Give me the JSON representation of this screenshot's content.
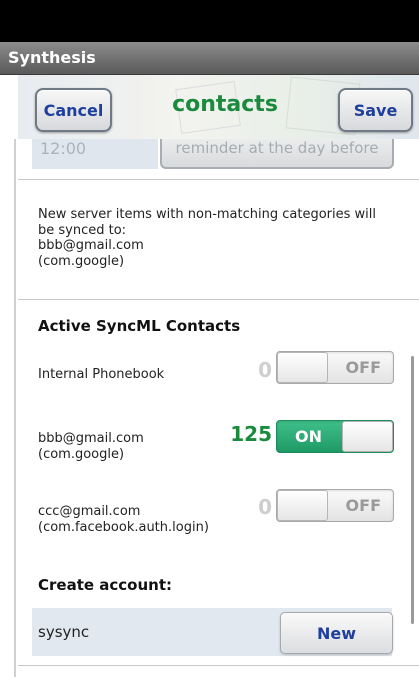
{
  "app_title": "Synthesis",
  "header": {
    "cancel_label": "Cancel",
    "title": "contacts",
    "save_label": "Save"
  },
  "partial_row": {
    "time_value": "12:00",
    "reminder_label": "reminder at the day before"
  },
  "info": {
    "line1": "New server items with non-matching categories will",
    "line2": "be synced to:",
    "line3": "bbb@gmail.com",
    "line4": "(com.google)"
  },
  "sync_section": {
    "title": "Active SyncML Contacts",
    "rows": [
      {
        "label_line1": "Internal Phonebook",
        "label_line2": "",
        "count": "0",
        "state": "OFF",
        "on": false
      },
      {
        "label_line1": "bbb@gmail.com",
        "label_line2": "(com.google)",
        "count": "125",
        "state": "ON",
        "on": true
      },
      {
        "label_line1": "ccc@gmail.com",
        "label_line2": "(com.facebook.auth.login)",
        "count": "0",
        "state": "OFF",
        "on": false
      }
    ]
  },
  "create_account": {
    "title": "Create account:",
    "account_name": "sysync",
    "new_label": "New"
  },
  "colors": {
    "title_green": "#1a8a3d",
    "button_blue": "#1f3f9e",
    "toggle_on": "#1f9a66"
  }
}
